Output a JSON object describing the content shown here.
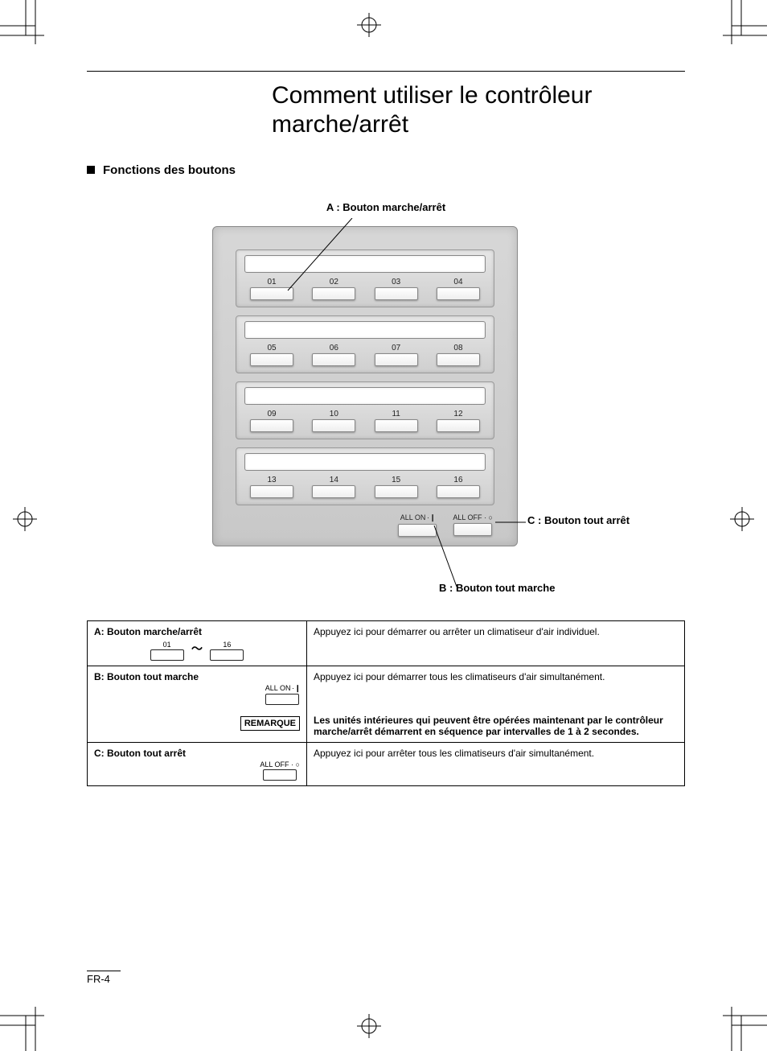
{
  "title_line1": "Comment utiliser le contrôleur",
  "title_line2": "marche/arrêt",
  "section": "Fonctions des boutons",
  "label_a": "A : Bouton marche/arrêt",
  "label_b": "B :  Bouton tout marche",
  "label_c": "C : Bouton tout arrêt",
  "device": {
    "unit_numbers": [
      "01",
      "02",
      "03",
      "04",
      "05",
      "06",
      "07",
      "08",
      "09",
      "10",
      "11",
      "12",
      "13",
      "14",
      "15",
      "16"
    ],
    "all_on_label": "ALL ON",
    "all_off_label": "ALL OFF"
  },
  "table": {
    "rowA": {
      "name": "A: Bouton marche/arrêt",
      "range_from": "01",
      "range_to": "16",
      "desc": "Appuyez ici pour démarrer ou arrêter un climatiseur d'air individuel."
    },
    "rowB": {
      "name": "B: Bouton tout marche",
      "icon_label": "ALL ON",
      "desc": "Appuyez ici pour démarrer tous les climatiseurs d'air simultanément.",
      "note_label": "REMARQUE",
      "note_text": "Les unités intérieures qui peuvent être opérées maintenant par le contrôleur marche/arrêt démarrent en séquence par intervalles de 1 à 2 secondes."
    },
    "rowC": {
      "name": "C: Bouton tout arrêt",
      "icon_label": "ALL OFF",
      "desc": "Appuyez ici pour arrêter tous les climatiseurs d'air simultanément."
    }
  },
  "page_num": "FR-4"
}
